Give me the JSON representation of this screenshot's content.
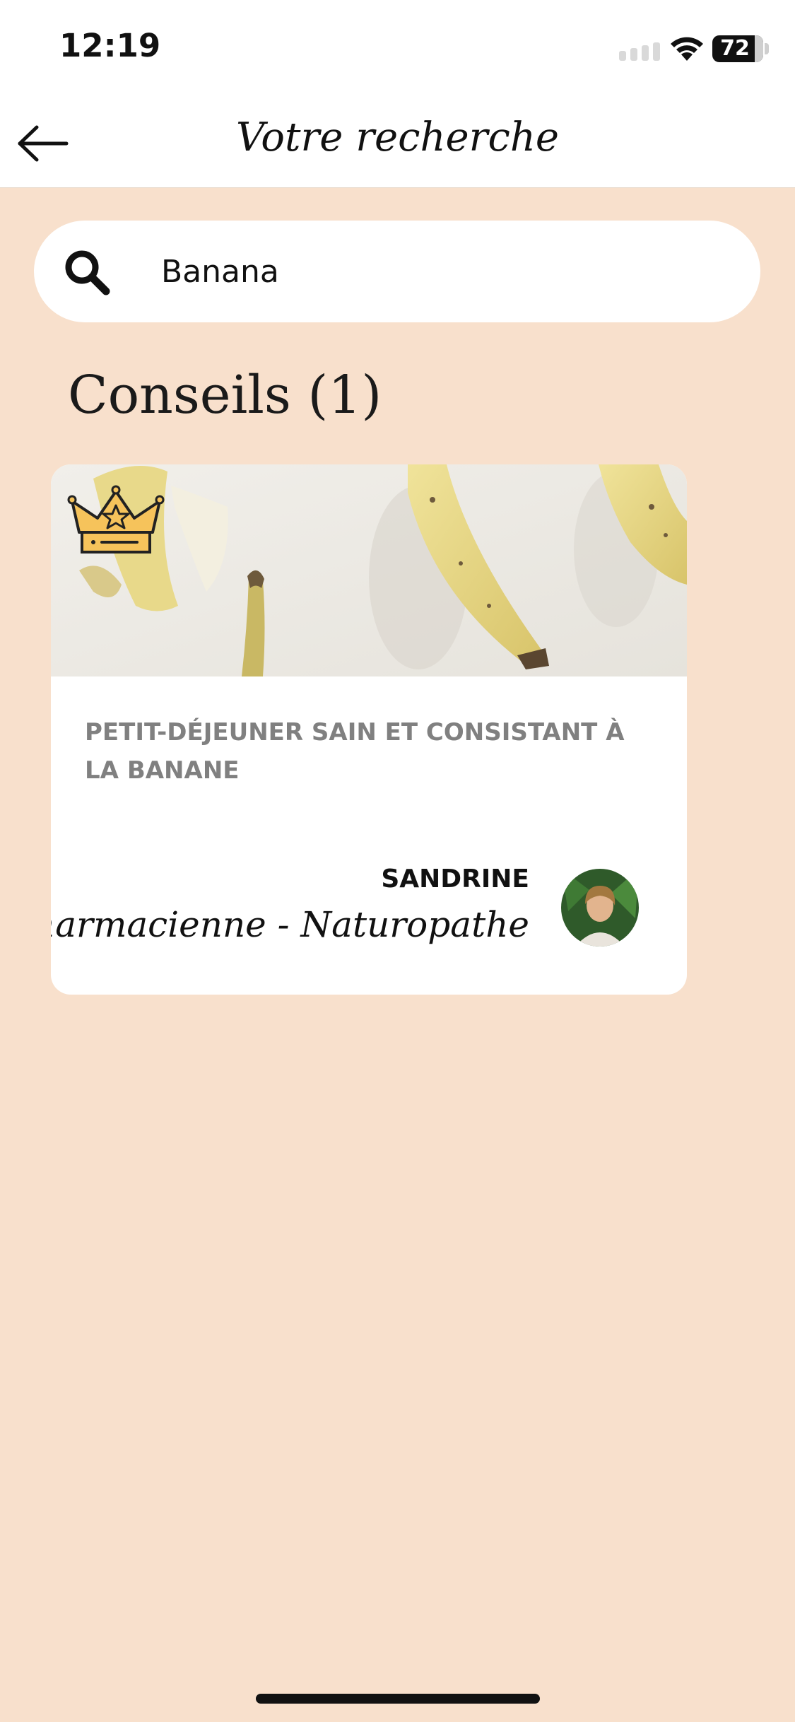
{
  "status_bar": {
    "time": "12:19",
    "battery": "72",
    "icons": [
      "signal-icon",
      "wifi-icon",
      "battery-icon"
    ]
  },
  "header": {
    "title": "Votre recherche",
    "back_icon": "arrow-left-icon"
  },
  "search": {
    "value": "Banana",
    "icon": "search-icon"
  },
  "results": {
    "section_title": "Conseils (1)",
    "items": [
      {
        "title": "Petit-déjeuner sain et consistant à la banane",
        "badge_icon": "crown-icon",
        "author_name": "SANDRINE",
        "author_role": "Pharmacienne - Naturopathe"
      }
    ]
  },
  "colors": {
    "background": "#f8e0cc",
    "surface": "#ffffff",
    "muted_text": "#808080",
    "crown": "#f6c35b"
  }
}
